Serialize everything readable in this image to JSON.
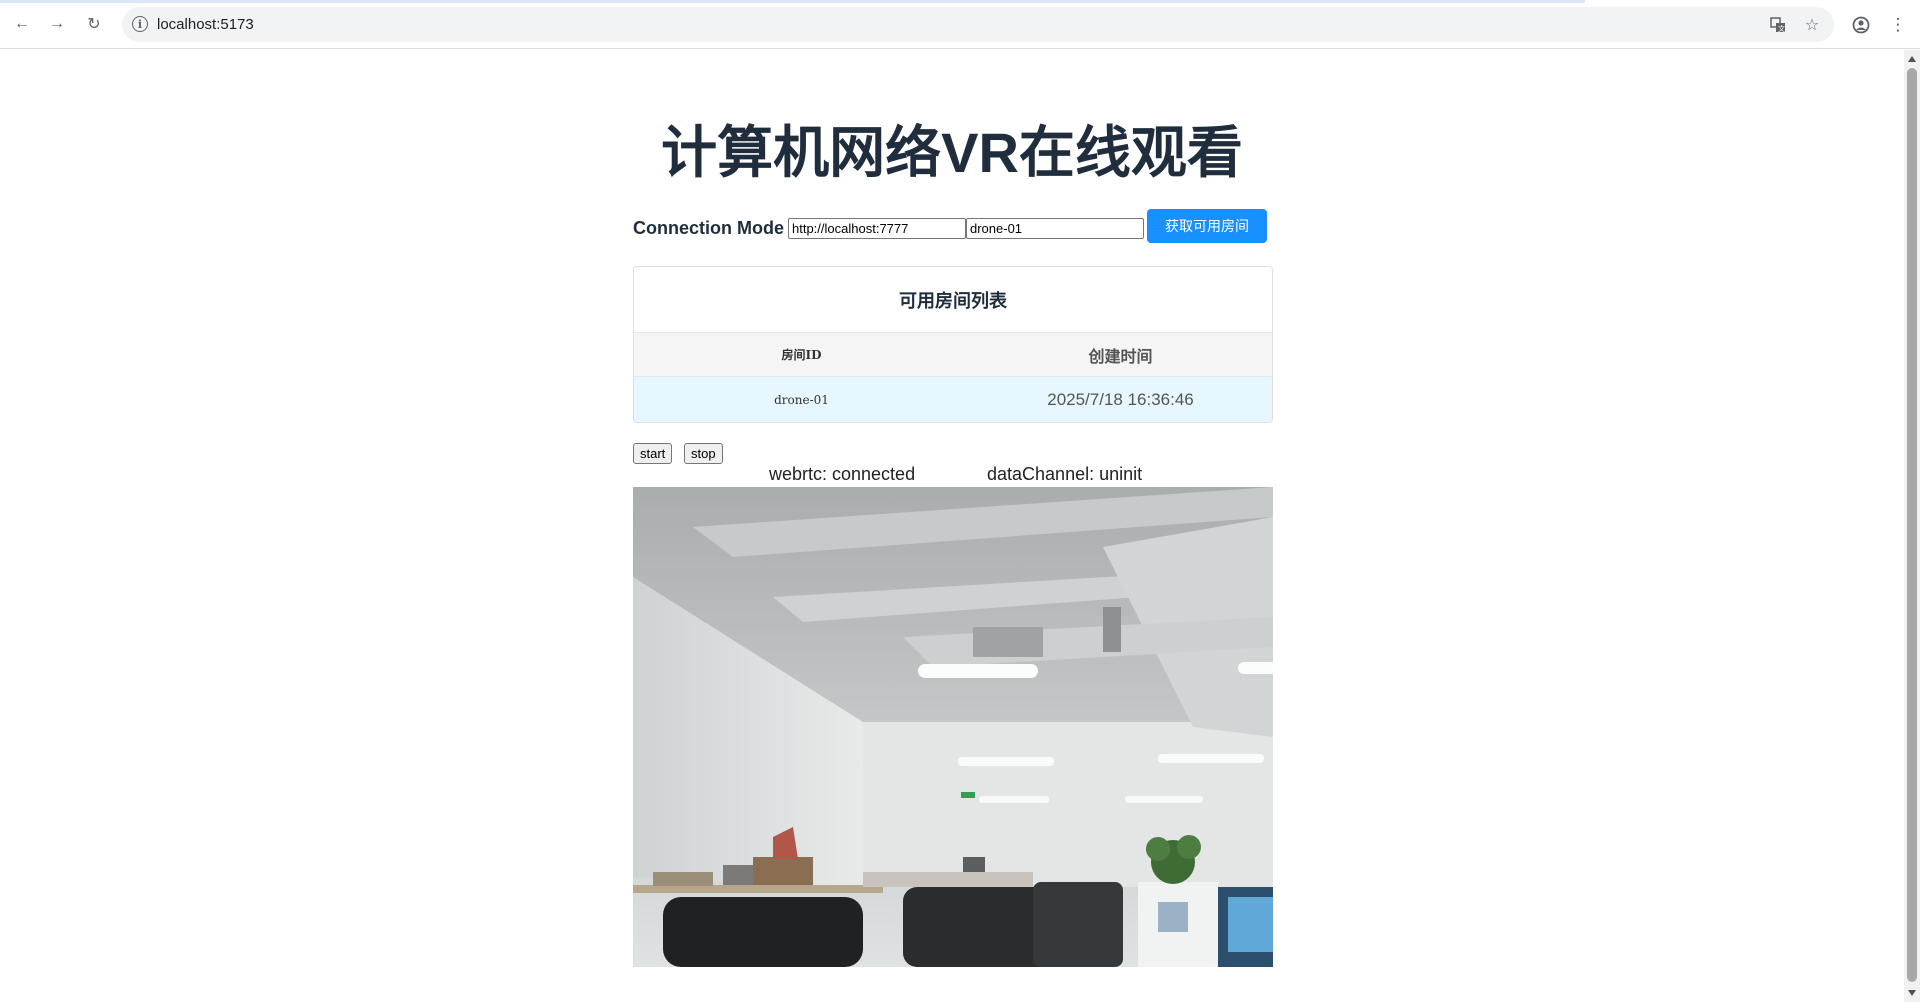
{
  "browser": {
    "url": "localhost:5173"
  },
  "page": {
    "title": "计算机网络VR在线观看"
  },
  "connection": {
    "label": "Connection Mode",
    "server_url": "http://localhost:7777",
    "room_id": "drone-01",
    "fetch_button": "获取可用房间"
  },
  "rooms": {
    "title": "可用房间列表",
    "columns": [
      "房间ID",
      "创建时间"
    ],
    "rows": [
      {
        "id": "drone-01",
        "created": "2025/7/18 16:36:46"
      }
    ]
  },
  "controls": {
    "start": "start",
    "stop": "stop"
  },
  "status": {
    "webrtc": "webrtc: connected",
    "datachannel": "dataChannel: uninit"
  }
}
